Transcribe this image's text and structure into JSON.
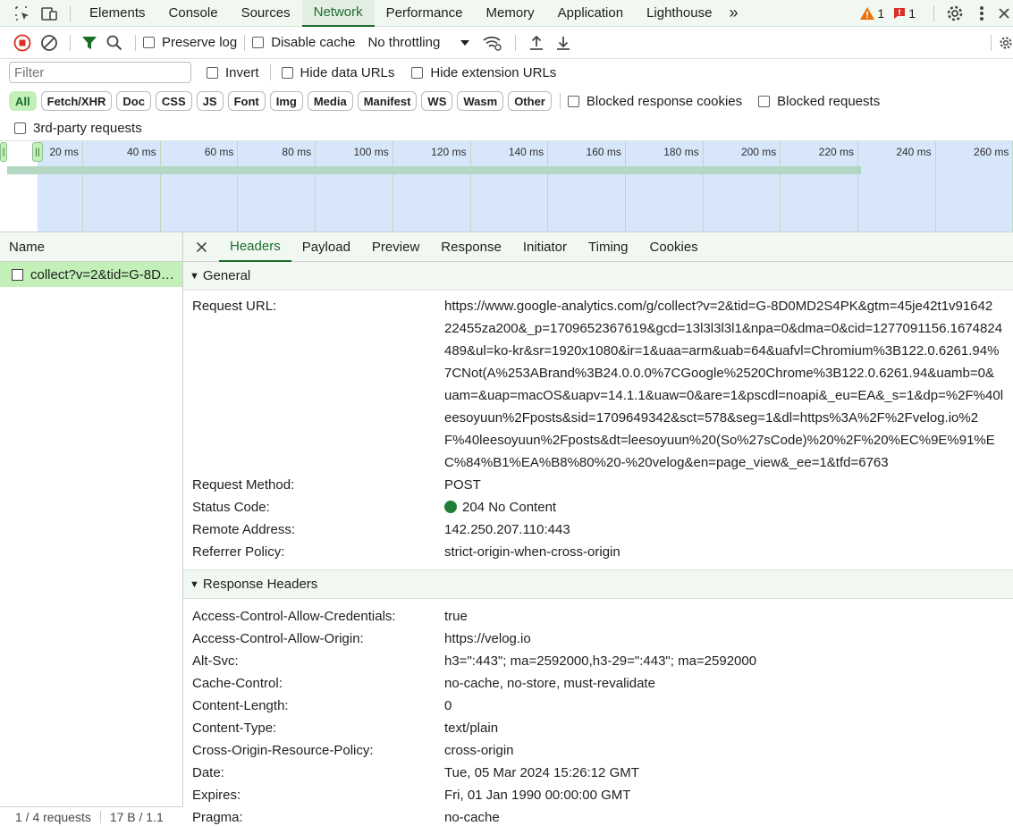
{
  "tabs": [
    "Elements",
    "Console",
    "Sources",
    "Network",
    "Performance",
    "Memory",
    "Application",
    "Lighthouse"
  ],
  "more_tabs": "»",
  "warnings_count": "1",
  "errors_count": "1",
  "toolbar": {
    "preserve_log": "Preserve log",
    "disable_cache": "Disable cache",
    "throttling": "No throttling"
  },
  "filter": {
    "placeholder": "Filter",
    "invert": "Invert",
    "hide_data_urls": "Hide data URLs",
    "hide_extension_urls": "Hide extension URLs"
  },
  "type_filters": [
    "All",
    "Fetch/XHR",
    "Doc",
    "CSS",
    "JS",
    "Font",
    "Img",
    "Media",
    "Manifest",
    "WS",
    "Wasm",
    "Other"
  ],
  "blocked_response_cookies": "Blocked response cookies",
  "blocked_requests": "Blocked requests",
  "third_party": "3rd-party requests",
  "timeline_labels": [
    "20 ms",
    "40 ms",
    "60 ms",
    "80 ms",
    "100 ms",
    "120 ms",
    "140 ms",
    "160 ms",
    "180 ms",
    "200 ms",
    "220 ms",
    "240 ms",
    "260 ms"
  ],
  "list": {
    "header": "Name",
    "row": "collect?v=2&tid=G-8D…",
    "footer_requests": "1 / 4 requests",
    "footer_size": "17 B / 1.1"
  },
  "detail_tabs": [
    "Headers",
    "Payload",
    "Preview",
    "Response",
    "Initiator",
    "Timing",
    "Cookies"
  ],
  "general": {
    "title": "General",
    "request_url_label": "Request URL:",
    "request_url_lines": [
      "https://www.google-analytics.com/g/collect?v=2&tid=G-8D0MD2S4PK&gtm=45je42t1v91642",
      "22455za200&_p=1709652367619&gcd=13l3l3l3l1&npa=0&dma=0&cid=1277091156.1674824",
      "489&ul=ko-kr&sr=1920x1080&ir=1&uaa=arm&uab=64&uafvl=Chromium%3B122.0.6261.94%",
      "7CNot(A%253ABrand%3B24.0.0.0%7CGoogle%2520Chrome%3B122.0.6261.94&uamb=0&",
      "uam=&uap=macOS&uapv=14.1.1&uaw=0&are=1&pscdl=noapi&_eu=EA&_s=1&dp=%2F%40l",
      "eesoyuun%2Fposts&sid=1709649342&sct=578&seg=1&dl=https%3A%2F%2Fvelog.io%2",
      "F%40leesoyuun%2Fposts&dt=leesoyuun%20(So%27sCode)%20%2F%20%EC%9E%91%E",
      "C%84%B1%EA%B8%80%20-%20velog&en=page_view&_ee=1&tfd=6763"
    ],
    "method_label": "Request Method:",
    "method": "POST",
    "status_label": "Status Code:",
    "status": "204 No Content",
    "remote_label": "Remote Address:",
    "remote": "142.250.207.110:443",
    "referrer_label": "Referrer Policy:",
    "referrer": "strict-origin-when-cross-origin"
  },
  "response_headers": {
    "title": "Response Headers",
    "rows": [
      {
        "k": "Access-Control-Allow-Credentials:",
        "v": "true"
      },
      {
        "k": "Access-Control-Allow-Origin:",
        "v": "https://velog.io"
      },
      {
        "k": "Alt-Svc:",
        "v": "h3=\":443\"; ma=2592000,h3-29=\":443\"; ma=2592000"
      },
      {
        "k": "Cache-Control:",
        "v": "no-cache, no-store, must-revalidate"
      },
      {
        "k": "Content-Length:",
        "v": "0"
      },
      {
        "k": "Content-Type:",
        "v": "text/plain"
      },
      {
        "k": "Cross-Origin-Resource-Policy:",
        "v": "cross-origin"
      },
      {
        "k": "Date:",
        "v": "Tue, 05 Mar 2024 15:26:12 GMT"
      },
      {
        "k": "Expires:",
        "v": "Fri, 01 Jan 1990 00:00:00 GMT"
      },
      {
        "k": "Pragma:",
        "v": "no-cache"
      }
    ]
  },
  "colors": {
    "accent": "#1b6d2a",
    "selected_bg": "#c2f0b8",
    "status_ok": "#1e7e34",
    "record_red": "#d93025"
  }
}
